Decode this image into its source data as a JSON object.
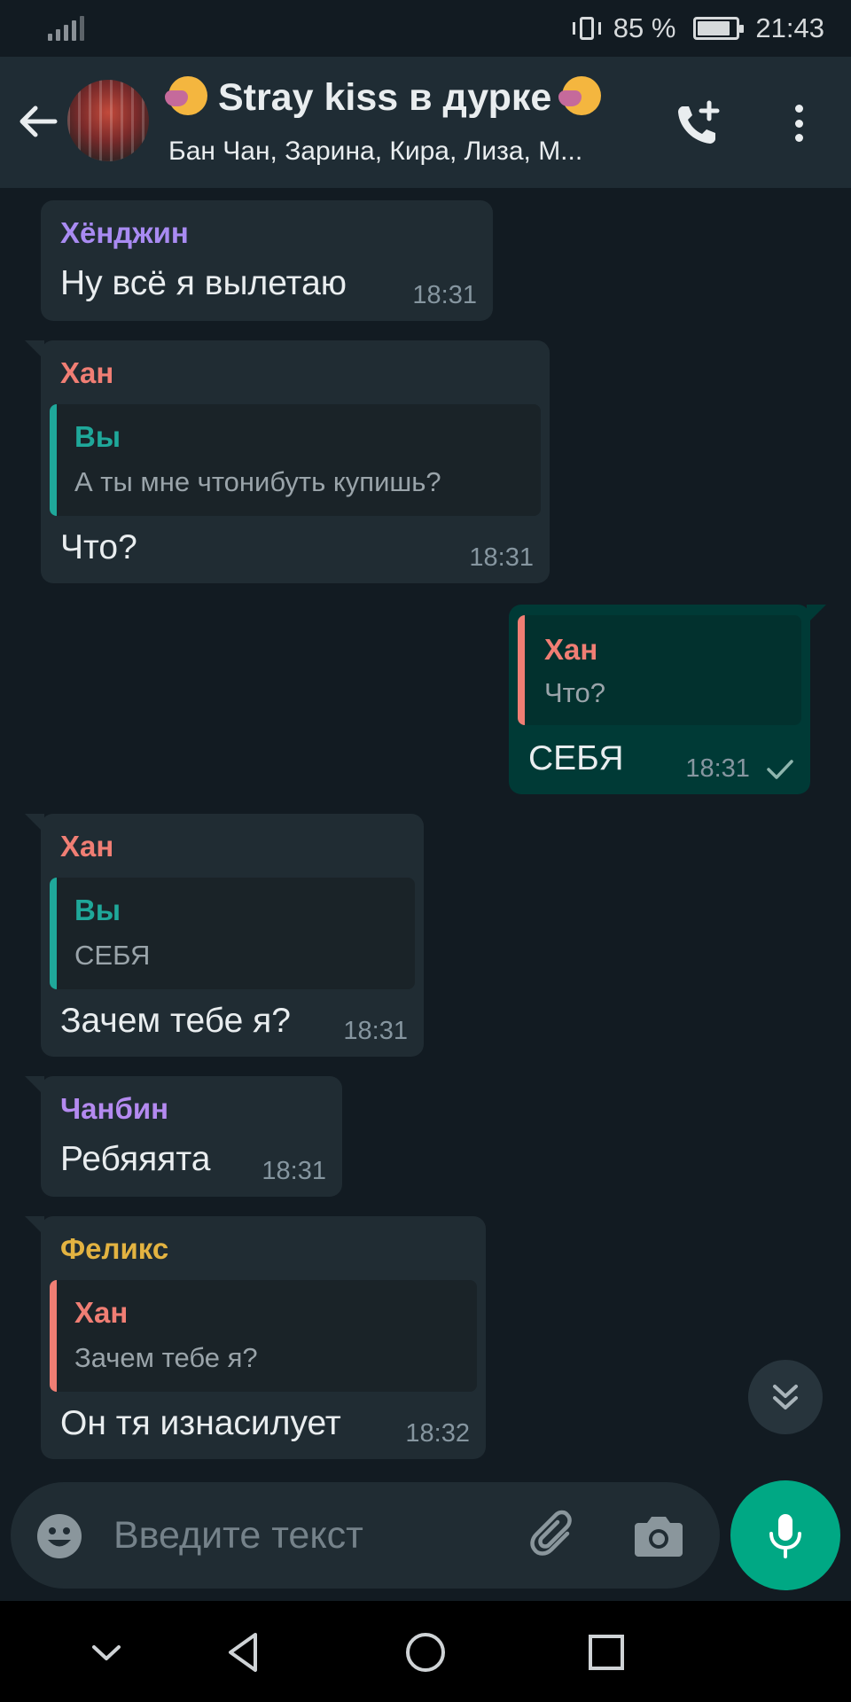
{
  "status_bar": {
    "battery_percent": "85 %",
    "battery_level": 0.85,
    "time": "21:43"
  },
  "header": {
    "title": "Stray kiss в дурке",
    "members": "Бан Чан, Зарина, Кира, Лиза, М..."
  },
  "messages": [
    {
      "sender": "Хёнджин",
      "sender_color": "#a98bf2",
      "text": "Ну всё я вылетаю",
      "time": "18:31",
      "direction": "in"
    },
    {
      "sender": "Хан",
      "sender_color": "#f07e74",
      "quote_sender": "Вы",
      "quote_sender_color": "#1fa89a",
      "quote_text": "А ты мне чтонибуть купишь?",
      "text": "Что?",
      "time": "18:31",
      "direction": "in"
    },
    {
      "quote_sender": "Хан",
      "quote_sender_color": "#f07e74",
      "quote_text": "Что?",
      "text": "СЕБЯ",
      "time": "18:31",
      "direction": "out",
      "status": "sent"
    },
    {
      "sender": "Хан",
      "sender_color": "#f07e74",
      "quote_sender": "Вы",
      "quote_sender_color": "#1fa89a",
      "quote_text": "СЕБЯ",
      "text": "Зачем тебе я?",
      "time": "18:31",
      "direction": "in"
    },
    {
      "sender": "Чанбин",
      "sender_color": "#b48af0",
      "text": "Ребяяята",
      "time": "18:31",
      "direction": "in"
    },
    {
      "sender": "Феликс",
      "sender_color": "#e3b341",
      "quote_sender": "Хан",
      "quote_sender_color": "#f07e74",
      "quote_text": "Зачем тебе я?",
      "text": "Он тя изнасилует",
      "time": "18:32",
      "direction": "in"
    }
  ],
  "composer": {
    "placeholder": "Введите текст"
  },
  "colors": {
    "background": "#121b22",
    "header": "#1f2c34",
    "bubble_in": "#202c33",
    "bubble_out": "#003a36",
    "accent": "#00a884"
  },
  "icons": {
    "back": "arrow-left-icon",
    "call": "add-call-icon",
    "menu": "more-vert-icon",
    "emoji": "emoji-icon",
    "attach": "paperclip-icon",
    "camera": "camera-icon",
    "mic": "mic-icon",
    "scroll": "double-chevron-down-icon"
  }
}
